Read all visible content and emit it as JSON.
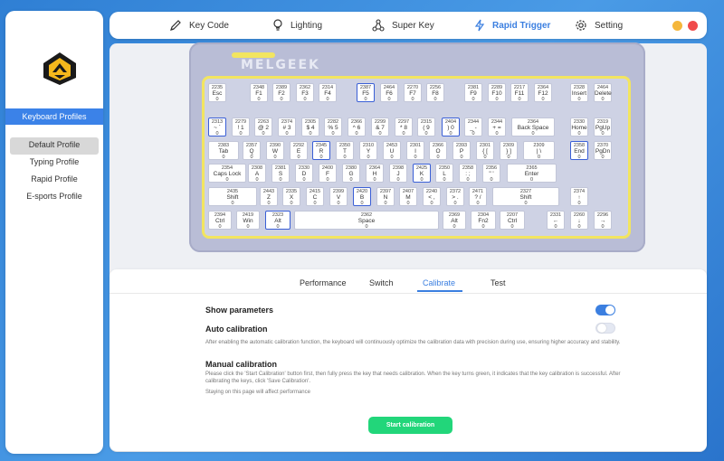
{
  "colors": {
    "accent": "#3b7fe0",
    "highlight_border": "#3a5fd6",
    "plate_outline": "#f2e560",
    "start_button": "#22d67a",
    "dot_min": "#f5b73b",
    "dot_close": "#f04b4b"
  },
  "sidebar": {
    "logo": "melgeek-logo",
    "profiles_header": "Keyboard Profiles",
    "profiles": [
      "Default Profile",
      "Typing Profile",
      "Rapid Profile",
      "E-sports Profile"
    ],
    "active_profile": "Default Profile"
  },
  "nav": {
    "items": [
      {
        "label": "Key Code",
        "icon": "pen-icon"
      },
      {
        "label": "Lighting",
        "icon": "bulb-icon"
      },
      {
        "label": "Super Key",
        "icon": "nodes-icon"
      },
      {
        "label": "Rapid Trigger",
        "icon": "bolt-icon"
      },
      {
        "label": "Setting",
        "icon": "gear-icon"
      }
    ],
    "active": "Rapid Trigger"
  },
  "keyboard": {
    "brand": "MELGEEK",
    "rows": [
      [
        [
          "2235",
          "Esc",
          "0"
        ],
        [
          "2348",
          "F1",
          "0"
        ],
        [
          "2389",
          "F2",
          "0"
        ],
        [
          "2362",
          "F3",
          "0"
        ],
        [
          "2314",
          "F4",
          "0"
        ],
        [
          "2387",
          "F5",
          "0"
        ],
        [
          "2464",
          "F6",
          "0"
        ],
        [
          "2270",
          "F7",
          "0"
        ],
        [
          "2256",
          "F8",
          "0"
        ],
        [
          "2381",
          "F9",
          "0"
        ],
        [
          "2289",
          "F10",
          "0"
        ],
        [
          "2217",
          "F11",
          "0"
        ],
        [
          "2364",
          "F12",
          "0"
        ],
        [
          "2328",
          "Insert",
          "0"
        ],
        [
          "2464",
          "Delete",
          "0"
        ]
      ],
      [
        [
          "2313",
          "~ `",
          "0"
        ],
        [
          "2279",
          "! 1",
          "0"
        ],
        [
          "2263",
          "@ 2",
          "0"
        ],
        [
          "2374",
          "# 3",
          "0"
        ],
        [
          "2305",
          "$ 4",
          "0"
        ],
        [
          "2282",
          "% 5",
          "0"
        ],
        [
          "2366",
          "^ 6",
          "0"
        ],
        [
          "2299",
          "& 7",
          "0"
        ],
        [
          "2297",
          "* 8",
          "0"
        ],
        [
          "2315",
          "( 9",
          "0"
        ],
        [
          "2404",
          ") 0",
          "0"
        ],
        [
          "2344",
          "_ -",
          "0"
        ],
        [
          "2344",
          "+ =",
          "0"
        ],
        [
          "2364",
          "Back Space",
          "0"
        ],
        [
          "2330",
          "Home",
          "0"
        ],
        [
          "2319",
          "PgUp",
          "0"
        ]
      ],
      [
        [
          "2383",
          "Tab",
          "0"
        ],
        [
          "2357",
          "Q",
          "0"
        ],
        [
          "2390",
          "W",
          "0"
        ],
        [
          "2292",
          "E",
          "0"
        ],
        [
          "2345",
          "R",
          "0"
        ],
        [
          "2350",
          "T",
          "0"
        ],
        [
          "2310",
          "Y",
          "0"
        ],
        [
          "2453",
          "U",
          "0"
        ],
        [
          "2301",
          "I",
          "0"
        ],
        [
          "2366",
          "O",
          "0"
        ],
        [
          "2393",
          "P",
          "0"
        ],
        [
          "2301",
          "{ [",
          "0"
        ],
        [
          "2309",
          "} ]",
          "0"
        ],
        [
          "2309",
          "| \\",
          "0"
        ],
        [
          "2358",
          "End",
          "0"
        ],
        [
          "2370",
          "PgDn",
          "0"
        ]
      ],
      [
        [
          "2354",
          "Caps Lock",
          "0"
        ],
        [
          "2308",
          "A",
          "0"
        ],
        [
          "2381",
          "S",
          "0"
        ],
        [
          "2330",
          "D",
          "0"
        ],
        [
          "2400",
          "F",
          "0"
        ],
        [
          "2380",
          "G",
          "0"
        ],
        [
          "2364",
          "H",
          "0"
        ],
        [
          "2398",
          "J",
          "0"
        ],
        [
          "2425",
          "K",
          "0"
        ],
        [
          "2350",
          "L",
          "0"
        ],
        [
          "2358",
          ": ;",
          "0"
        ],
        [
          "2356",
          "\" '",
          "0"
        ],
        [
          "2365",
          "Enter",
          "0"
        ]
      ],
      [
        [
          "2435",
          "Shift",
          "0"
        ],
        [
          "2443",
          "Z",
          "0"
        ],
        [
          "2335",
          "X",
          "0"
        ],
        [
          "2415",
          "C",
          "0"
        ],
        [
          "2399",
          "V",
          "0"
        ],
        [
          "2420",
          "B",
          "0"
        ],
        [
          "2397",
          "N",
          "0"
        ],
        [
          "2407",
          "M",
          "0"
        ],
        [
          "2240",
          "< ,",
          "0"
        ],
        [
          "2372",
          "> .",
          "0"
        ],
        [
          "2471",
          "? /",
          "0"
        ],
        [
          "2327",
          "Shift",
          "0"
        ],
        [
          "2374",
          "↑",
          "0"
        ]
      ],
      [
        [
          "2394",
          "Ctrl",
          "0"
        ],
        [
          "2419",
          "Win",
          "0"
        ],
        [
          "2323",
          "Alt",
          "0"
        ],
        [
          "2362",
          "Space",
          "0"
        ],
        [
          "2369",
          "Alt",
          "0"
        ],
        [
          "2304",
          "Fn2",
          "0"
        ],
        [
          "2207",
          "Ctrl",
          "0"
        ],
        [
          "2331",
          "←",
          "0"
        ],
        [
          "2260",
          "↓",
          "0"
        ],
        [
          "2296",
          "→",
          "0"
        ]
      ]
    ]
  },
  "tabs": {
    "items": [
      "Performance",
      "Switch",
      "Calibrate",
      "Test"
    ],
    "active": "Calibrate"
  },
  "calibrate": {
    "show_params": {
      "label": "Show parameters",
      "on": true
    },
    "auto": {
      "label": "Auto calibration",
      "on": false,
      "desc": "After enabling the automatic calibration function, the keyboard will continuously optimize the calibration data with precision during use, ensuring higher accuracy and stability."
    },
    "manual": {
      "label": "Manual calibration",
      "desc": "Please click the 'Start Calibration' button first, then fully press the key that needs calibration. When the key turns green, it indicates that the key calibration is successful. After calibrating the keys, click 'Save Calibration'.",
      "note": "Staying on this page will affect performance"
    },
    "start_label": "Start calibration"
  }
}
